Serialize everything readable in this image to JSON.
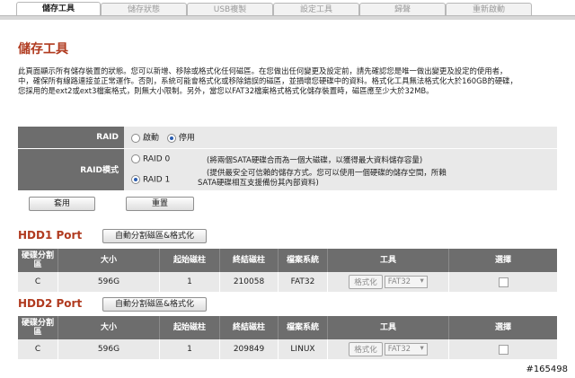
{
  "tabs": [
    {
      "label": "儲存工具",
      "active": true
    },
    {
      "label": "儲存狀態",
      "active": false
    },
    {
      "label": "USB複製",
      "active": false
    },
    {
      "label": "設定工具",
      "active": false
    },
    {
      "label": "歸聲",
      "active": false
    },
    {
      "label": "重新啟動",
      "active": false
    }
  ],
  "page_title": "儲存工具",
  "description": [
    "此頁面顯示所有儲存裝置的狀態。您可以新增、移除或格式化任何磁區。在您做出任何變更及設定前，請先確認您是唯一做出變更及設定的使用者，",
    "中，確保所有線路連接並正常運作。否則，系統可能會格式化或移除錯誤的磁區，並損壞您硬碟中的資料。格式化工具無法格式化大於160GB的硬碟，",
    "您採用的是ext2或ext3檔案格式，則無大小限制。另外，當您以FAT32檔案格式格式化儲存裝置時，磁區應至少大於32MB。"
  ],
  "raid": {
    "label": "RAID",
    "options": [
      "啟動",
      "停用"
    ],
    "selected": "停用",
    "mode_label": "RAID模式",
    "modes": [
      {
        "name": "RAID 0",
        "desc": "(將兩個SATA硬碟合而為一個大磁碟，以獲得最大資料儲存容量)",
        "selected": false
      },
      {
        "name": "RAID 1",
        "desc": "(提供最安全可信賴的儲存方式。您可以使用一個硬碟的儲存空間，所賴",
        "desc2": "SATA硬碟相互支援備份其內部資料)",
        "selected": true
      }
    ],
    "apply_label": "套用",
    "reset_label": "重置"
  },
  "table_headers": [
    "硬碟分割區",
    "大小",
    "起始磁柱",
    "終結磁柱",
    "檔案系統",
    "工具",
    "選擇"
  ],
  "hdd_ports": [
    {
      "title": "HDD1 Port",
      "auto_button": "自動分割磁區&格式化",
      "rows": [
        {
          "partition": "C",
          "size": "596G",
          "start": "1",
          "end": "210058",
          "fs": "FAT32",
          "format_label": "格式化",
          "format_type": "FAT32"
        }
      ]
    },
    {
      "title": "HDD2 Port",
      "auto_button": "自動分割磁區&格式化",
      "rows": [
        {
          "partition": "C",
          "size": "596G",
          "start": "1",
          "end": "209849",
          "fs": "LINUX",
          "format_label": "格式化",
          "format_type": "FAT32"
        }
      ]
    }
  ],
  "watermark": "#165498",
  "colors": {
    "accent": "#b03a1f",
    "header_bg": "#6d6d6d",
    "cell_bg": "#e9e9e9"
  }
}
